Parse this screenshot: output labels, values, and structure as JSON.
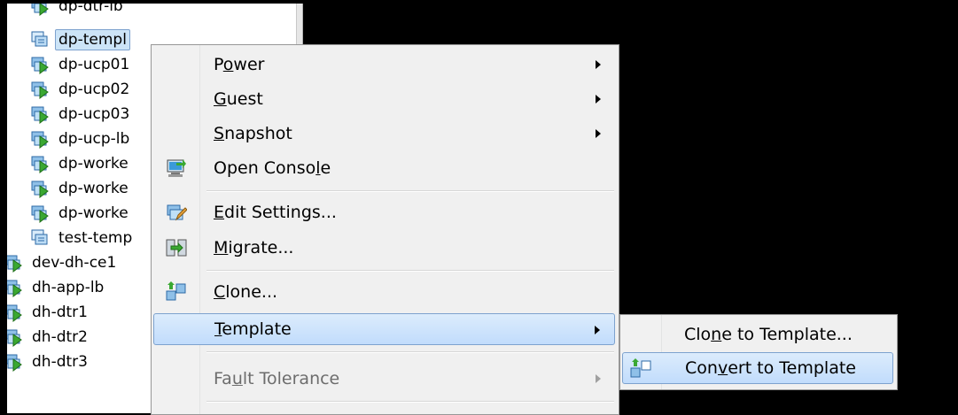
{
  "tree": {
    "items": [
      {
        "label": "dp-dtr-lb"
      },
      {
        "label": "dp-templ"
      },
      {
        "label": "dp-ucp01"
      },
      {
        "label": "dp-ucp02"
      },
      {
        "label": "dp-ucp03"
      },
      {
        "label": "dp-ucp-lb"
      },
      {
        "label": "dp-worke"
      },
      {
        "label": "dp-worke"
      },
      {
        "label": "dp-worke"
      },
      {
        "label": "test-temp"
      },
      {
        "label": "dev-dh-ce1"
      },
      {
        "label": "dh-app-lb"
      },
      {
        "label": "dh-dtr1"
      },
      {
        "label": "dh-dtr2"
      },
      {
        "label": "dh-dtr3"
      }
    ],
    "selected_label": "dp-templ"
  },
  "context_menu": {
    "power": {
      "pre": "P",
      "ul": "o",
      "post": "wer"
    },
    "guest": {
      "pre": "",
      "ul": "G",
      "post": "uest"
    },
    "snapshot": {
      "pre": "",
      "ul": "S",
      "post": "napshot"
    },
    "open_console": {
      "pre": "Open Conso",
      "ul": "l",
      "post": "e"
    },
    "edit_settings": {
      "pre": "",
      "ul": "E",
      "post": "dit Settings..."
    },
    "migrate": {
      "pre": "",
      "ul": "M",
      "post": "igrate..."
    },
    "clone": {
      "pre": "",
      "ul": "C",
      "post": "lone..."
    },
    "template": {
      "pre": "",
      "ul": "T",
      "post": "emplate"
    },
    "fault_tolerance": {
      "pre": "Fa",
      "ul": "u",
      "post": "lt Tolerance"
    }
  },
  "submenu": {
    "clone_to_template": {
      "pre": "Clo",
      "ul": "n",
      "post": "e to Template..."
    },
    "convert_to_template": {
      "pre": "Con",
      "ul": "v",
      "post": "ert to Template"
    }
  },
  "colors": {
    "highlight": "#c1dcfc",
    "highlight_border": "#7da2ce",
    "menu_bg": "#f0f0f0",
    "vm_icon_green": "#3aa832",
    "template_icon_blue": "#3a78c8"
  }
}
